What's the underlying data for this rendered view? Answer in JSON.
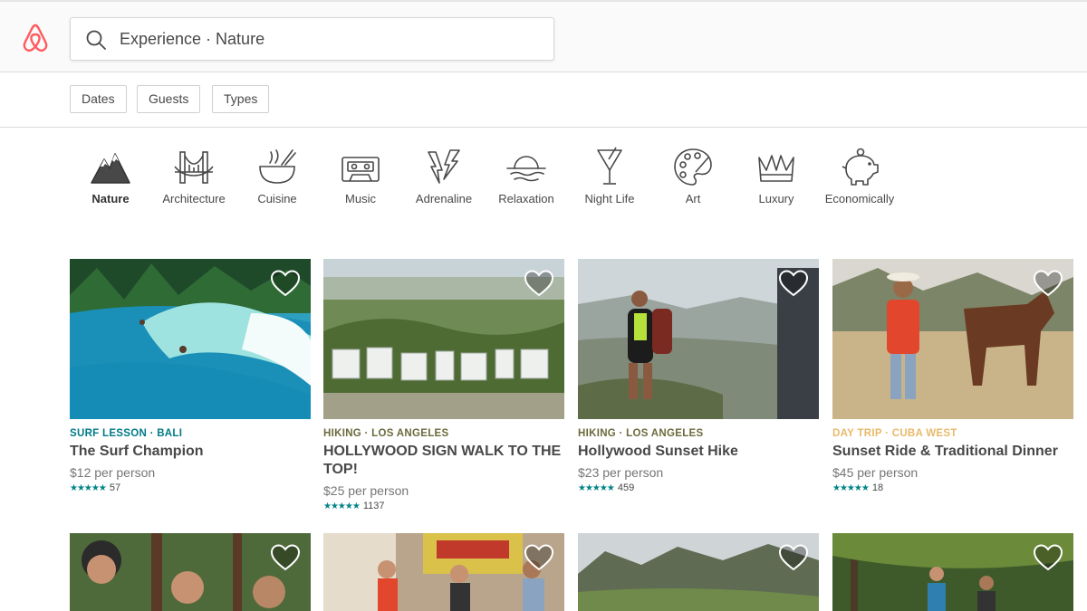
{
  "brand": {
    "logo_icon": "airbnb-belo-icon",
    "color": "#ff5a5f"
  },
  "search": {
    "icon": "search-icon",
    "value": "Experience · Nature"
  },
  "filters": [
    "Dates",
    "Guests",
    "Types"
  ],
  "categories": [
    {
      "label": "Nature",
      "icon": "mountain-icon",
      "active": true
    },
    {
      "label": "Architecture",
      "icon": "bridge-icon",
      "active": false
    },
    {
      "label": "Cuisine",
      "icon": "bowl-icon",
      "active": false
    },
    {
      "label": "Music",
      "icon": "cassette-icon",
      "active": false
    },
    {
      "label": "Adrenaline",
      "icon": "lightning-icon",
      "active": false
    },
    {
      "label": "Relaxation",
      "icon": "sunset-icon",
      "active": false
    },
    {
      "label": "Night Life",
      "icon": "cocktail-icon",
      "active": false
    },
    {
      "label": "Art",
      "icon": "palette-icon",
      "active": false
    },
    {
      "label": "Luxury",
      "icon": "crown-icon",
      "active": false
    },
    {
      "label": "Economically",
      "icon": "piggy-bank-icon",
      "active": false
    }
  ],
  "experiences": [
    {
      "kicker": "SURF LESSON · BALI",
      "kicker_color": "#007a87",
      "title": "The Surf Champion",
      "price": "$12 per person",
      "stars": "★★★★★",
      "reviews": "57"
    },
    {
      "kicker": "HIKING · LOS ANGELES",
      "kicker_color": "#6b6b3e",
      "title": "HOLLYWOOD SIGN WALK TO THE TOP!",
      "price": "$25 per person",
      "stars": "★★★★★",
      "reviews": "1137"
    },
    {
      "kicker": "HIKING · LOS ANGELES",
      "kicker_color": "#6b6b3e",
      "title": "Hollywood Sunset Hike",
      "price": "$23 per person",
      "stars": "★★★★★",
      "reviews": "459"
    },
    {
      "kicker": "DAY TRIP · CUBA WEST",
      "kicker_color": "#e8b96a",
      "title": "Sunset Ride & Traditional Dinner",
      "price": "$45 per person",
      "stars": "★★★★★",
      "reviews": "18"
    }
  ],
  "colors": {
    "rating_star": "#008489",
    "text": "#484848",
    "muted": "#767676"
  }
}
